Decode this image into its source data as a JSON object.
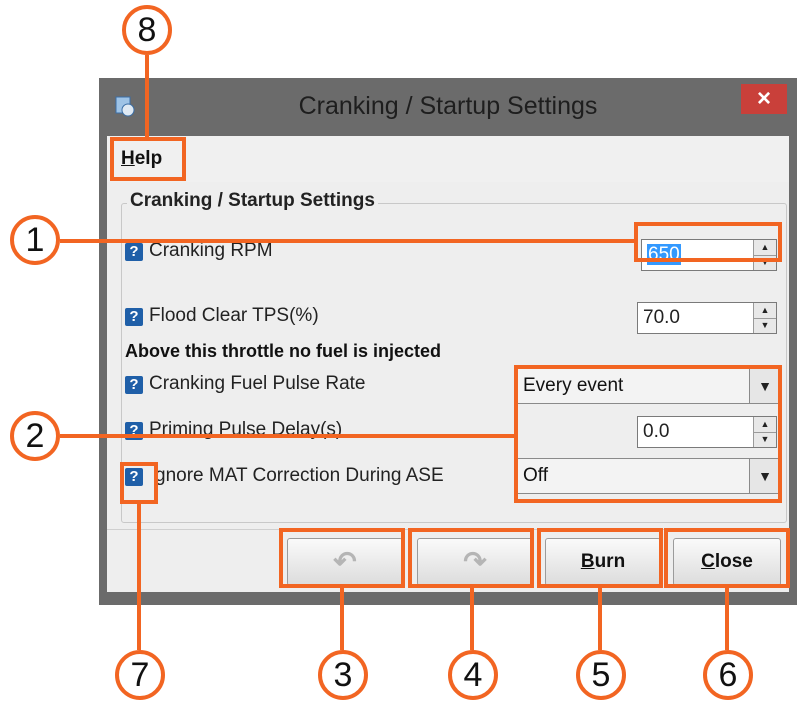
{
  "window": {
    "title": "Cranking / Startup Settings",
    "close_glyph": "×"
  },
  "menu": {
    "help_label": "Help",
    "help_mnemonic": "H",
    "help_rest": "elp"
  },
  "group": {
    "title": "Cranking / Startup Settings"
  },
  "fields": {
    "cranking_rpm": {
      "label": "Cranking RPM",
      "value": "650"
    },
    "flood_clear": {
      "label": "Flood Clear TPS(%)",
      "value": "70.0"
    },
    "flood_note": "Above this throttle no fuel is injected",
    "pulse_rate": {
      "label": "Cranking Fuel Pulse Rate",
      "value": "Every event"
    },
    "priming_delay": {
      "label": "Priming Pulse Delay(s)",
      "value": "0.0"
    },
    "ignore_mat": {
      "label": "gnore MAT Correction During ASE",
      "value": "Off"
    }
  },
  "buttons": {
    "undo_glyph": "↶",
    "redo_glyph": "↷",
    "burn_label": "Burn",
    "burn_mnemonic": "B",
    "burn_rest": "urn",
    "close_label": "Close",
    "close_mnemonic": "C",
    "close_rest": "lose"
  },
  "callouts": [
    "1",
    "2",
    "3",
    "4",
    "5",
    "6",
    "7",
    "8"
  ],
  "colors": {
    "accent": "#f26522",
    "help_icon": "#1f5fa8",
    "close_button": "#c9403a",
    "selection": "#3399ff"
  },
  "icons": {
    "help": "question-mark-icon",
    "spinner_up": "triangle-up-icon",
    "spinner_down": "triangle-down-icon",
    "combo_arrow": "triangle-down-icon"
  }
}
